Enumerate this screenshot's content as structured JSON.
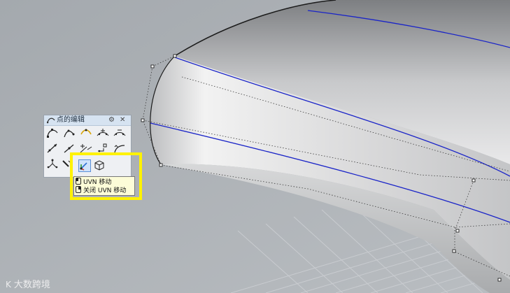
{
  "toolbar": {
    "title": "点的编辑",
    "settings_icon": "gear-icon",
    "close_icon": "close-icon",
    "buttons": [
      "control-points-on-icon",
      "edit-points-icon",
      "drag-mode-icon",
      "insert-knot-icon",
      "remove-knot-icon",
      "move-uvn-icon",
      "handlebar-icon",
      "insert-point-icon",
      "weight-icon",
      "adjust-end-bulge-icon",
      "soft-edit-icon",
      "nudge-icon"
    ]
  },
  "highlight": {
    "buttons": [
      "uvn-move-icon",
      "box-edit-icon"
    ]
  },
  "tooltip": {
    "left_click": "UVN 移动",
    "right_click": "关闭 UVN 移动"
  },
  "watermark": {
    "text": "大数跨境"
  },
  "colors": {
    "viewport_bg": "#aeb3b8",
    "highlight": "#fff200",
    "isocurve": "#1a24c8"
  }
}
